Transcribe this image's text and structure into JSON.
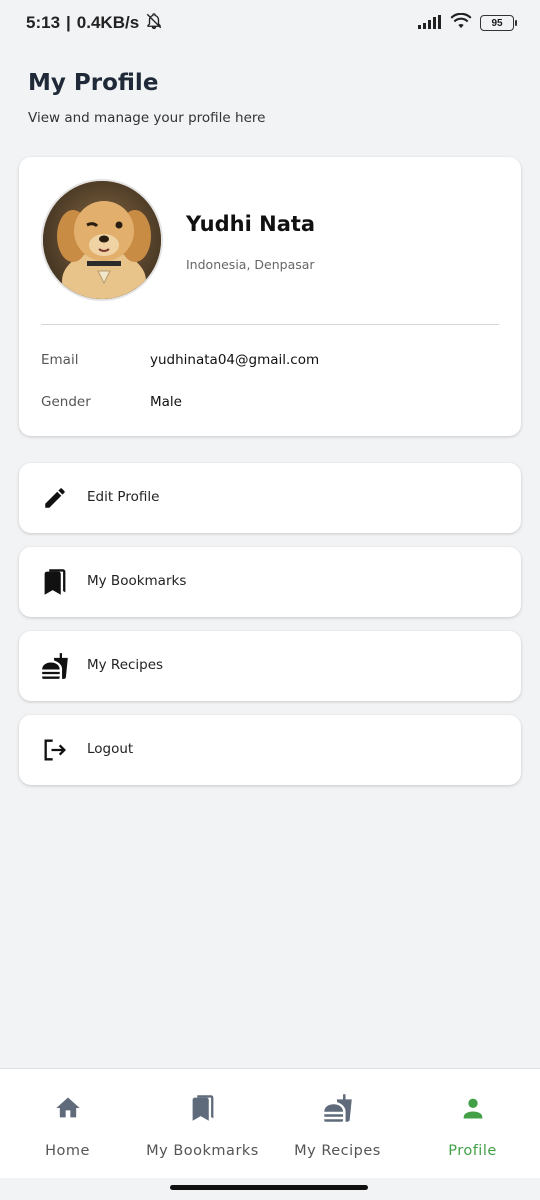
{
  "status_bar": {
    "time": "5:13",
    "speed": "0.4KB/s",
    "battery": "95"
  },
  "header": {
    "title": "My Profile",
    "subtitle": "View and manage your profile here"
  },
  "profile": {
    "name": "Yudhi Nata",
    "location": "Indonesia, Denpasar",
    "email_label": "Email",
    "email_value": "yudhinata04@gmail.com",
    "gender_label": "Gender",
    "gender_value": "Male"
  },
  "menu": {
    "items": [
      {
        "label": "Edit Profile",
        "icon": "pencil-icon"
      },
      {
        "label": "My Bookmarks",
        "icon": "bookmarks-icon"
      },
      {
        "label": "My Recipes",
        "icon": "fastfood-icon"
      },
      {
        "label": "Logout",
        "icon": "logout-icon"
      }
    ]
  },
  "bottom_nav": {
    "items": [
      {
        "label": "Home",
        "icon": "home-icon"
      },
      {
        "label": "My Bookmarks",
        "icon": "bookmarks-icon"
      },
      {
        "label": "My Recipes",
        "icon": "fastfood-icon"
      },
      {
        "label": "Profile",
        "icon": "person-icon"
      }
    ],
    "active": "Profile"
  },
  "colors": {
    "background": "#f2f3f5",
    "card": "#ffffff",
    "active": "#43a047",
    "inactive_icon": "#5f6b7a"
  }
}
